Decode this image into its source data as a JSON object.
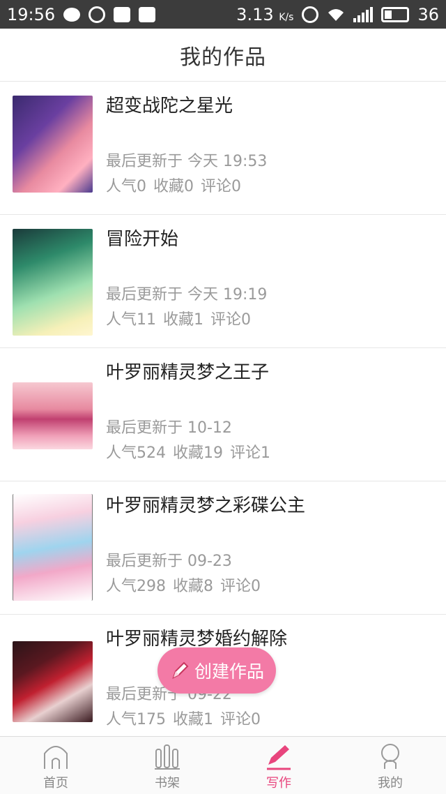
{
  "status_bar": {
    "time": "19:56",
    "speed": "3.13",
    "speed_unit": "K/s",
    "battery": "36"
  },
  "header": {
    "title": "我的作品"
  },
  "works": [
    {
      "title": "超变战陀之星光",
      "updated": "最后更新于 今天 19:53",
      "popularity": "人气0",
      "favorites": "收藏0",
      "comments": "评论0"
    },
    {
      "title": "冒险开始",
      "updated": "最后更新于 今天 19:19",
      "popularity": "人气11",
      "favorites": "收藏1",
      "comments": "评论0"
    },
    {
      "title": "叶罗丽精灵梦之王子",
      "updated": "最后更新于 10-12",
      "popularity": "人气524",
      "favorites": "收藏19",
      "comments": "评论1"
    },
    {
      "title": "叶罗丽精灵梦之彩碟公主",
      "updated": "最后更新于 09-23",
      "popularity": "人气298",
      "favorites": "收藏8",
      "comments": "评论0"
    },
    {
      "title": "叶罗丽精灵梦婚约解除",
      "updated": "最后更新于 09-22",
      "popularity": "人气175",
      "favorites": "收藏1",
      "comments": "评论0"
    }
  ],
  "create_button": {
    "label": "创建作品",
    "icon": "pencil-icon"
  },
  "bottom_nav": {
    "tabs": [
      {
        "label": "首页",
        "icon": "home-icon"
      },
      {
        "label": "书架",
        "icon": "bookshelf-icon"
      },
      {
        "label": "写作",
        "icon": "pencil-icon"
      },
      {
        "label": "我的",
        "icon": "person-icon"
      }
    ],
    "active_tab": "写作",
    "accent_color": "#e8457d"
  },
  "colors": {
    "create_button": "#f37aa6",
    "status_bar": "#3c3c3c"
  }
}
